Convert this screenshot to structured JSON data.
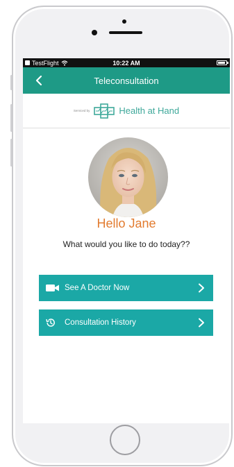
{
  "statusbar": {
    "app_label": "TestFlight",
    "time": "10:22 AM",
    "battery_level": 0.9
  },
  "navbar": {
    "title": "Teleconsultation",
    "back_icon": "chevron-left-icon"
  },
  "sponsor": {
    "prefix": "Serviced by",
    "brand": "Health at Hand"
  },
  "profile": {
    "greeting": "Hello Jane",
    "prompt": "What would you like to do today??"
  },
  "actions": [
    {
      "label": "See A Doctor Now",
      "icon": "video-camera-icon"
    },
    {
      "label": "Consultation History",
      "icon": "history-icon"
    }
  ],
  "colors": {
    "navbar": "#1e9a86",
    "button": "#1ba8a6",
    "greeting": "#e27b2f",
    "brand": "#3ea89a"
  }
}
